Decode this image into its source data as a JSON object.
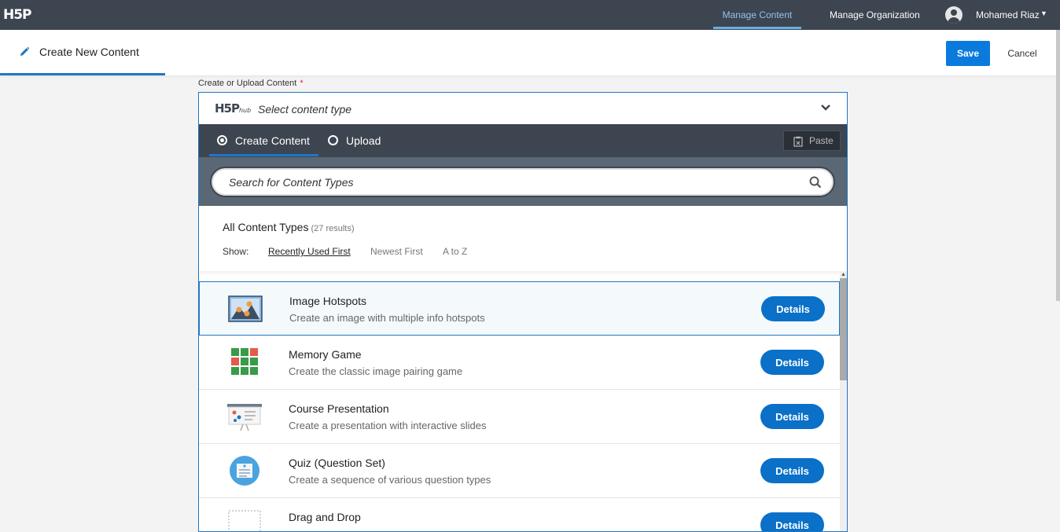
{
  "topbar": {
    "logo": "H5P",
    "nav": [
      {
        "label": "Manage Content",
        "active": true
      },
      {
        "label": "Manage Organization",
        "active": false
      }
    ],
    "user_name": "Mohamed Riaz"
  },
  "header": {
    "title": "Create New Content",
    "save_label": "Save",
    "cancel_label": "Cancel"
  },
  "field": {
    "label": "Create or Upload Content",
    "required_mark": "*"
  },
  "hub": {
    "logo_main": "H5P",
    "logo_sub": "hub",
    "select_placeholder": "Select content type",
    "tabs": [
      {
        "label": "Create Content",
        "checked": true
      },
      {
        "label": "Upload",
        "checked": false
      }
    ],
    "paste_label": "Paste",
    "search_placeholder": "Search for Content Types",
    "list_title": "All Content Types",
    "list_count": "(27 results)",
    "show_label": "Show:",
    "sort_options": [
      "Recently Used First",
      "Newest First",
      "A to Z"
    ],
    "items": [
      {
        "title": "Image Hotspots",
        "description": "Create an image with multiple info hotspots",
        "button": "Details",
        "icon": "image-hotspots-icon"
      },
      {
        "title": "Memory Game",
        "description": "Create the classic image pairing game",
        "button": "Details",
        "icon": "memory-game-icon"
      },
      {
        "title": "Course Presentation",
        "description": "Create a presentation with interactive slides",
        "button": "Details",
        "icon": "course-presentation-icon"
      },
      {
        "title": "Quiz (Question Set)",
        "description": "Create a sequence of various question types",
        "button": "Details",
        "icon": "quiz-icon"
      },
      {
        "title": "Drag and Drop",
        "description": "",
        "button": "Details",
        "icon": "drag-drop-icon"
      }
    ]
  },
  "colors": {
    "navbar": "#3d4550",
    "accent": "#1f76c6",
    "button_blue": "#0a70c8"
  }
}
